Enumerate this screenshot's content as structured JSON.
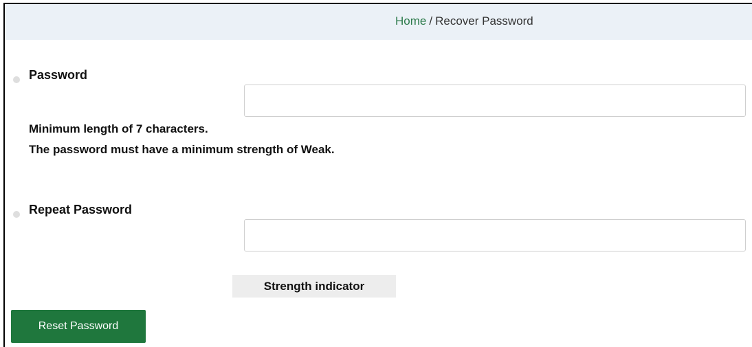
{
  "breadcrumb": {
    "home_label": "Home",
    "separator": "/",
    "current_label": "Recover Password"
  },
  "password": {
    "label": "Password",
    "value": "",
    "hint_min_length": "Minimum length of 7 characters.",
    "hint_strength": "The password must have a minimum strength of Weak."
  },
  "repeat_password": {
    "label": "Repeat Password",
    "value": ""
  },
  "strength_indicator": {
    "label": "Strength indicator"
  },
  "actions": {
    "reset_label": "Reset Password"
  },
  "colors": {
    "link": "#2c7a4b",
    "button": "#1f773d",
    "breadcrumb_bg": "#ebf1f7",
    "indicator_bg": "#ededed"
  }
}
